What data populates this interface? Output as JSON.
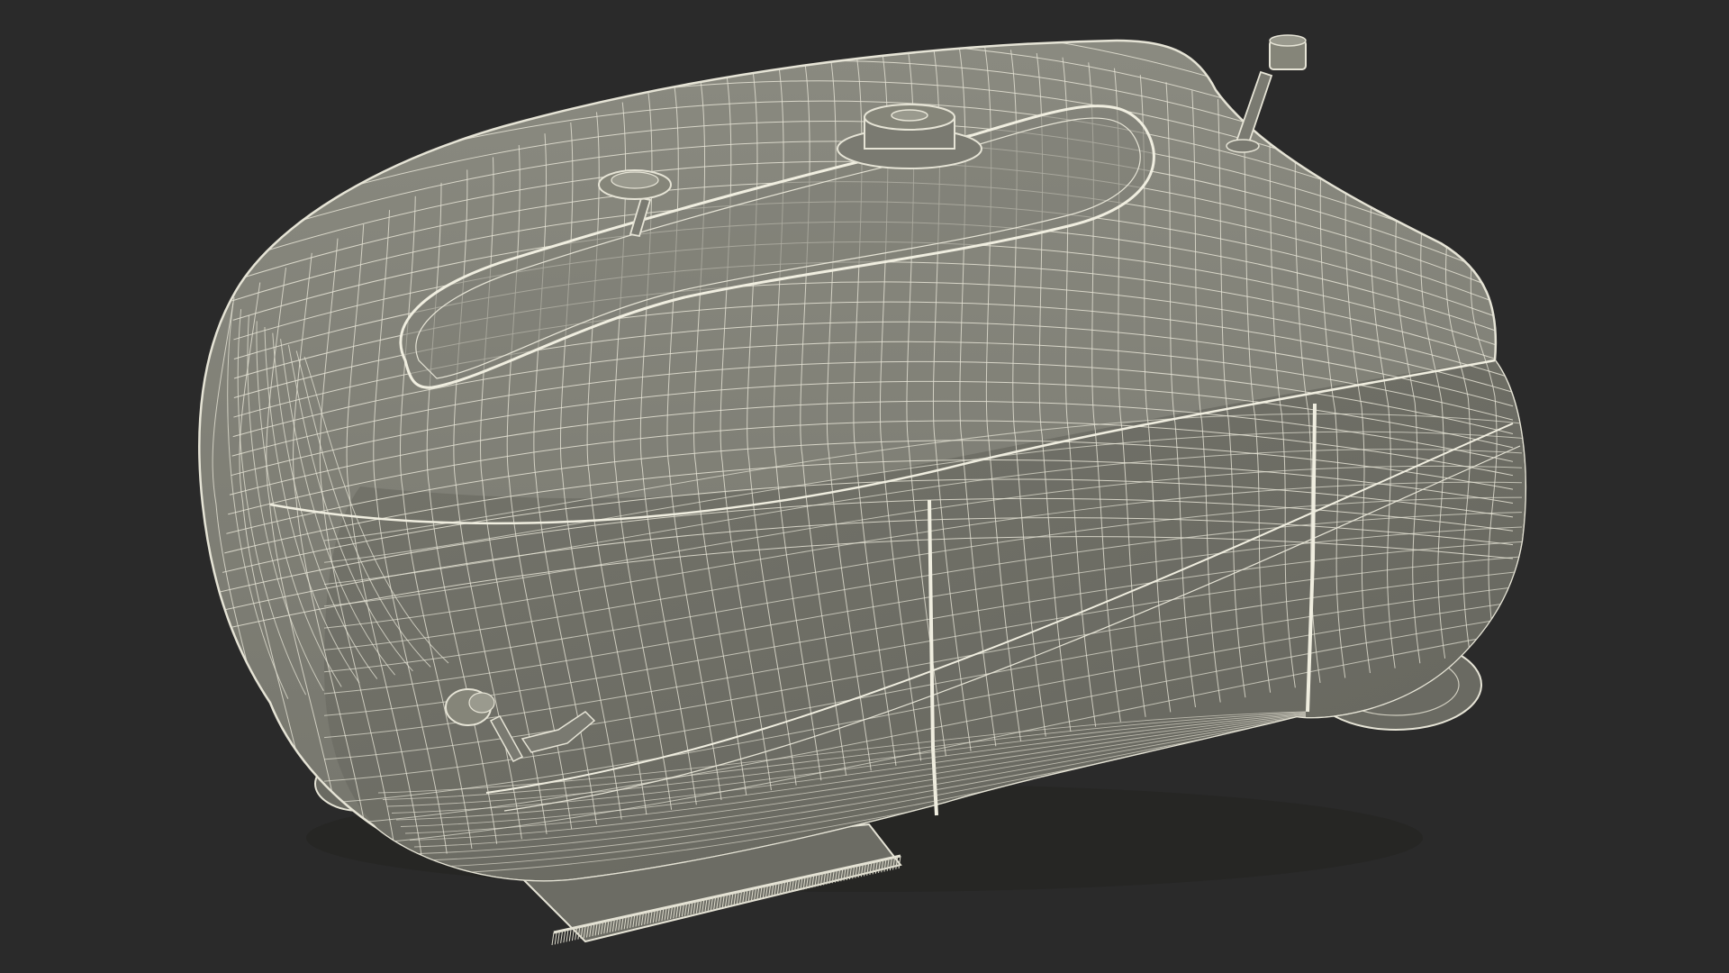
{
  "scene": {
    "subject": "wireframe-robot-mower",
    "colors": {
      "background": "#2a2a2a",
      "surface": "#76766d",
      "surface_light": "#8a8a80",
      "surface_dark": "#5e5e56",
      "wire": "#e6e4d6",
      "wire_faint": "#cfcdbf",
      "shadow": "#3a3a35"
    }
  }
}
